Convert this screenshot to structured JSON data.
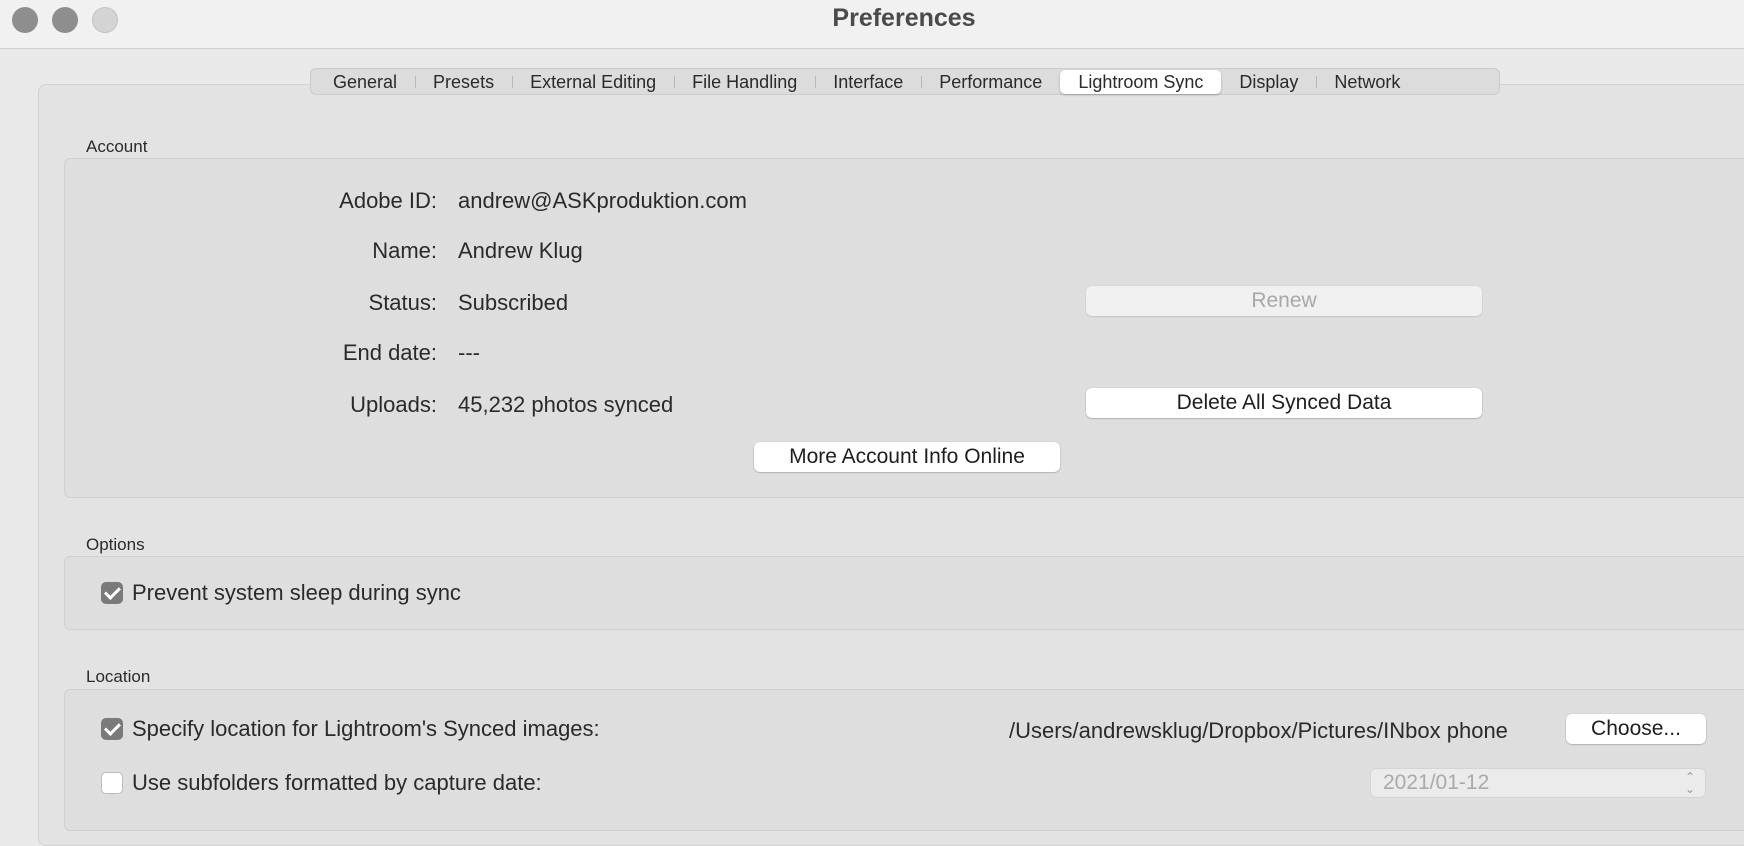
{
  "window": {
    "title": "Preferences"
  },
  "tabs": [
    {
      "label": "General"
    },
    {
      "label": "Presets"
    },
    {
      "label": "External Editing"
    },
    {
      "label": "File Handling"
    },
    {
      "label": "Interface"
    },
    {
      "label": "Performance"
    },
    {
      "label": "Lightroom Sync",
      "active": true
    },
    {
      "label": "Display"
    },
    {
      "label": "Network"
    }
  ],
  "account": {
    "section_label": "Account",
    "adobe_id_label": "Adobe ID:",
    "adobe_id_value": "andrew@ASKproduktion.com",
    "name_label": "Name:",
    "name_value": "Andrew Klug",
    "status_label": "Status:",
    "status_value": "Subscribed",
    "end_date_label": "End date:",
    "end_date_value": "---",
    "uploads_label": "Uploads:",
    "uploads_value": "45,232 photos synced",
    "renew_button": "Renew",
    "delete_button": "Delete All Synced Data",
    "more_info_button": "More Account Info Online"
  },
  "options": {
    "section_label": "Options",
    "prevent_sleep_label": "Prevent system sleep during sync",
    "prevent_sleep_checked": true
  },
  "location": {
    "section_label": "Location",
    "specify_label": "Specify location for Lightroom's Synced images:",
    "specify_checked": true,
    "path": "/Users/andrewsklug/Dropbox/Pictures/INbox phone",
    "choose_button": "Choose...",
    "subfolders_label": "Use subfolders formatted by capture date:",
    "subfolders_checked": false,
    "date_format": "2021/01-12"
  },
  "colors": {
    "window_bg": "#e9e9e9",
    "panel_bg": "#e3e3e3",
    "checkbox_checked": "#7a7a7a"
  }
}
